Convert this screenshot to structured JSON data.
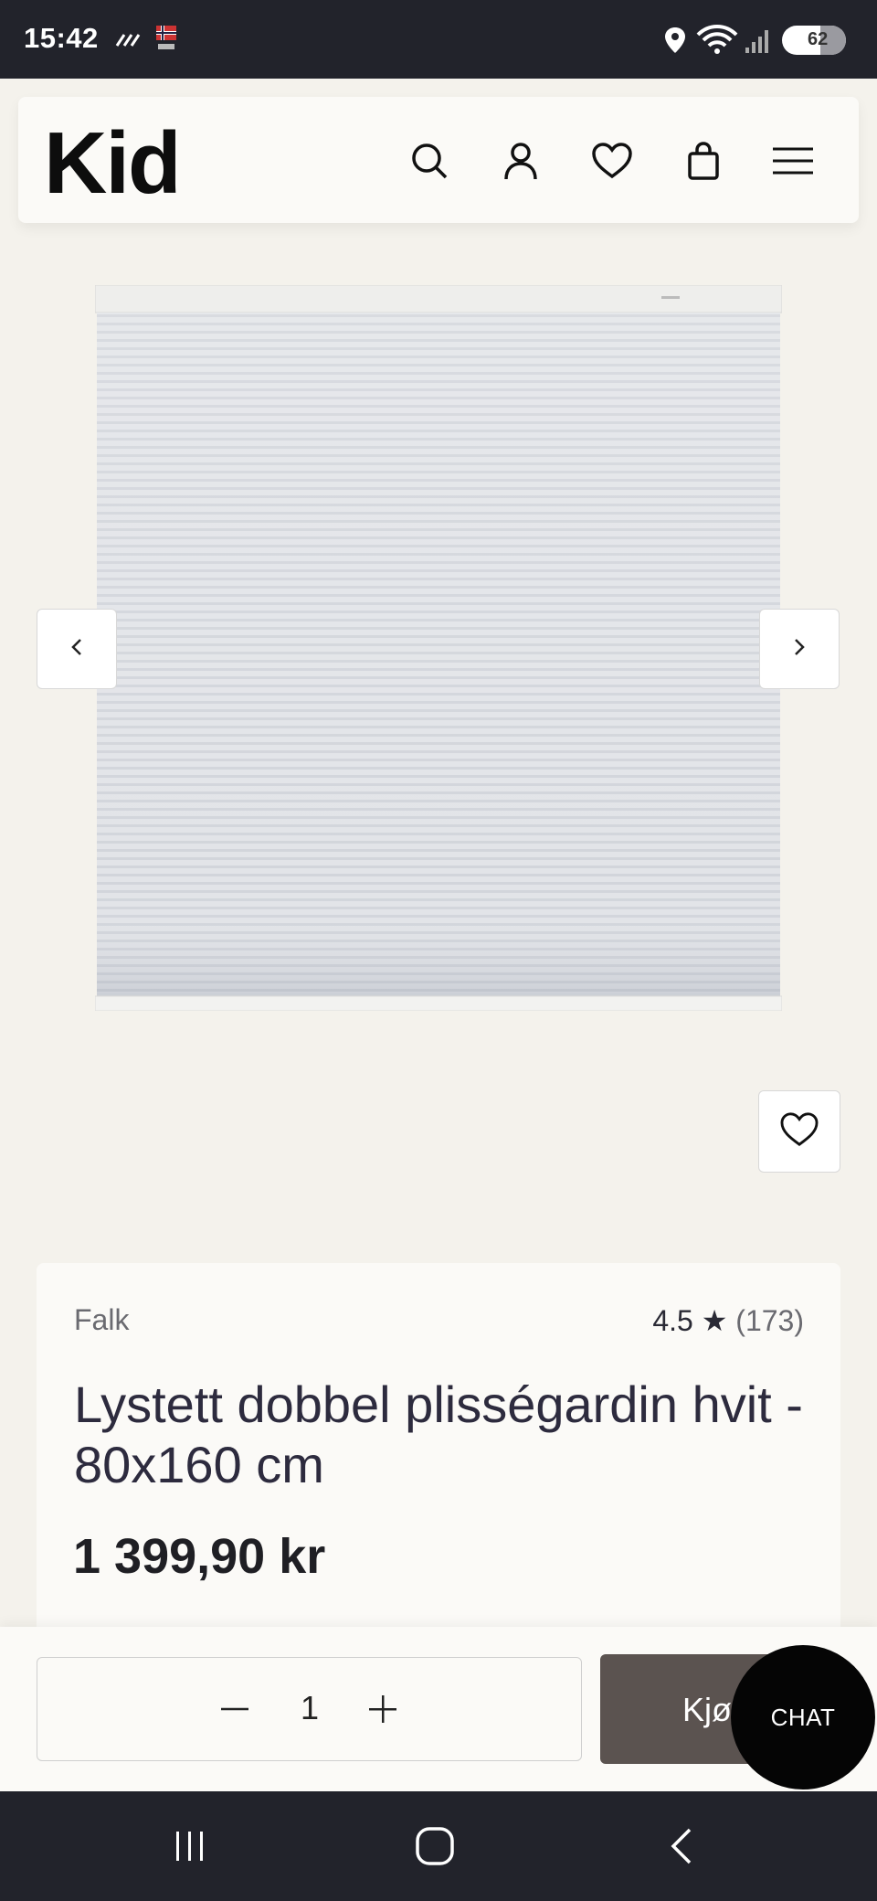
{
  "status_bar": {
    "time": "15:42",
    "battery_level": "62",
    "icons": [
      "signal-stream-icon",
      "flag-icon",
      "location-icon",
      "wifi-icon",
      "cell-signal-icon",
      "battery-icon"
    ]
  },
  "header": {
    "logo": "Kid",
    "icons": [
      "search-icon",
      "account-icon",
      "wishlist-icon",
      "cart-icon",
      "menu-icon"
    ]
  },
  "gallery": {
    "prev_icon": "chevron-left-icon",
    "next_icon": "chevron-right-icon",
    "favorite_icon": "heart-icon"
  },
  "product": {
    "brand": "Falk",
    "rating": "4.5",
    "rating_star": "★",
    "review_count": "(173)",
    "title": "Lystett dobbel plisségardin hvit - 80x160 cm",
    "price": "1 399,90 kr"
  },
  "purchase": {
    "quantity": "1",
    "buy_label": "Kjøp",
    "chat_label": "CHAT"
  },
  "colors": {
    "background": "#f4f2ec",
    "card": "#fbfaf7",
    "buy_button": "#5b5350",
    "chat_button": "#050505",
    "system_bars": "#22232b"
  }
}
